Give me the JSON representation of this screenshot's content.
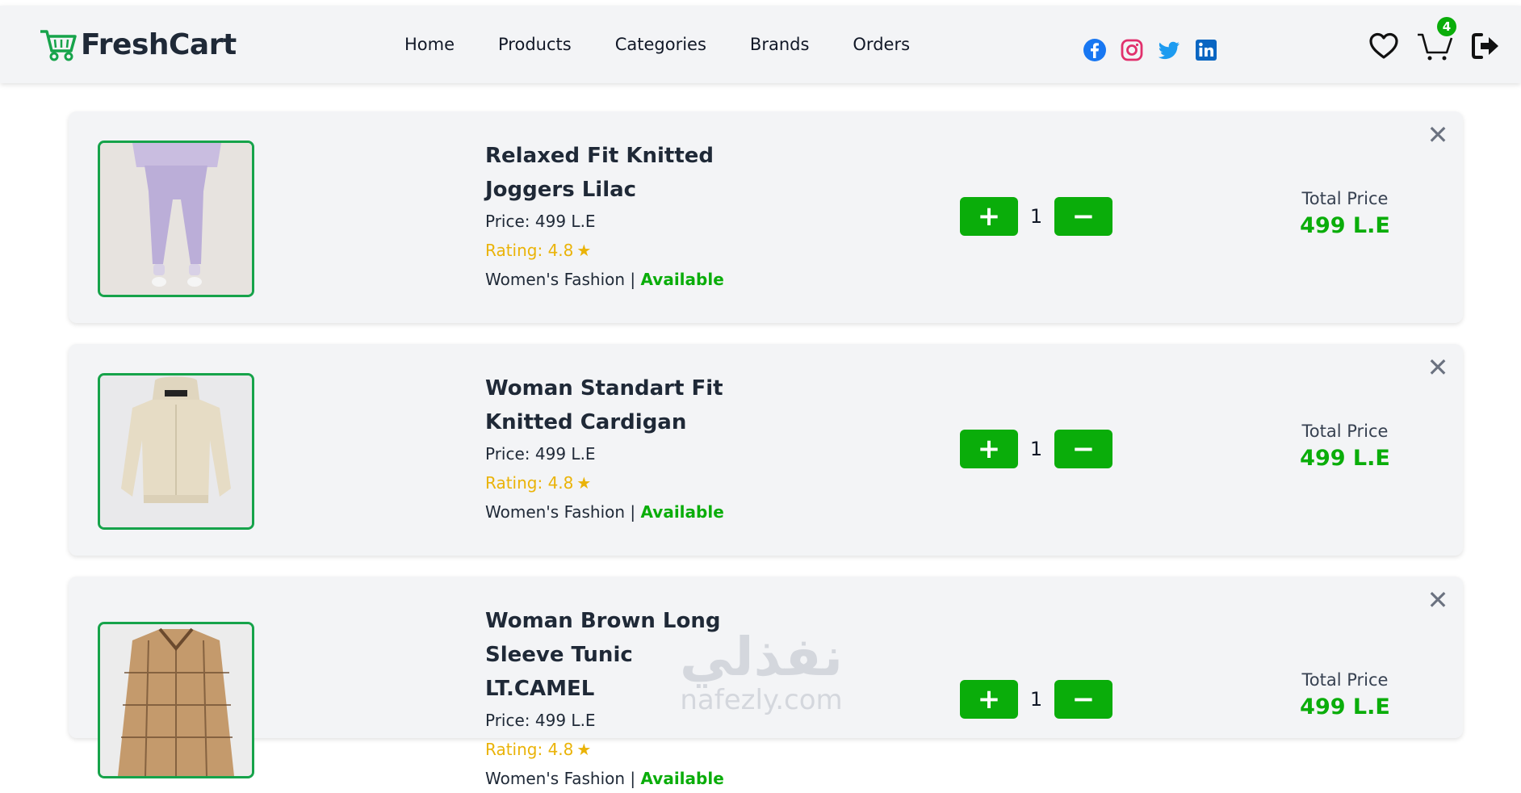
{
  "brand": {
    "name": "FreshCart",
    "icon": "cart-logo-icon",
    "accent": "#0aad0a"
  },
  "nav": {
    "links": [
      "Home",
      "Products",
      "Categories",
      "Brands",
      "Orders"
    ]
  },
  "socials": [
    "facebook-icon",
    "instagram-icon",
    "twitter-icon",
    "linkedin-icon"
  ],
  "actions": {
    "wishlist_icon": "heart-icon",
    "cart_icon": "cart-icon",
    "cart_count": "4",
    "logout_icon": "logout-icon"
  },
  "cart": {
    "items": [
      {
        "title_line1": "Relaxed Fit Knitted",
        "title_line2": "Joggers Lilac",
        "title_line3": "",
        "price_label": "Price:",
        "price": "499 L.E",
        "rating_label": "Rating: 4.8",
        "category": "Women's Fashion |",
        "status": "Available",
        "quantity": "1",
        "total_label": "Total Price",
        "total": "499 L.E"
      },
      {
        "title_line1": "Woman Standart Fit",
        "title_line2": "Knitted Cardigan",
        "title_line3": "",
        "price_label": "Price:",
        "price": "499 L.E",
        "rating_label": "Rating: 4.8",
        "category": "Women's Fashion |",
        "status": "Available",
        "quantity": "1",
        "total_label": "Total Price",
        "total": "499 L.E"
      },
      {
        "title_line1": "Woman Brown Long",
        "title_line2": "Sleeve Tunic",
        "title_line3": "LT.CAMEL",
        "price_label": "Price:",
        "price": "499 L.E",
        "rating_label": "Rating: 4.8",
        "category": "Women's Fashion |",
        "status": "Available",
        "quantity": "1",
        "total_label": "Total Price",
        "total": "499 L.E"
      }
    ],
    "plus_symbol": "+",
    "minus_symbol": "−",
    "remove_symbol": "✕"
  },
  "watermark": {
    "arabic": "نفذلي",
    "latin": "nafezly.com"
  }
}
